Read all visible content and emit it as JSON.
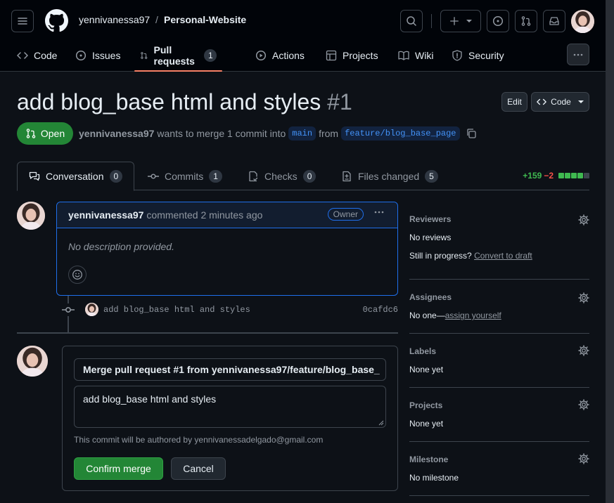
{
  "header": {
    "owner": "yennivanessa97",
    "separator": "/",
    "repo": "Personal-Website"
  },
  "nav": {
    "items": [
      {
        "label": "Code",
        "icon": "code-icon"
      },
      {
        "label": "Issues",
        "icon": "issue-icon"
      },
      {
        "label": "Pull requests",
        "icon": "pull-request-icon",
        "count": "1",
        "active": true
      },
      {
        "label": "Actions",
        "icon": "play-icon"
      },
      {
        "label": "Projects",
        "icon": "table-icon"
      },
      {
        "label": "Wiki",
        "icon": "book-icon"
      },
      {
        "label": "Security",
        "icon": "shield-icon"
      }
    ]
  },
  "pr": {
    "title": "add blog_base html and styles",
    "number": "#1",
    "edit_label": "Edit",
    "code_label": "Code",
    "state": "Open",
    "author": "yennivanessa97",
    "meta_text": "wants to merge 1 commit into",
    "base_branch": "main",
    "from_text": "from",
    "head_branch": "feature/blog_base_page"
  },
  "tabs": [
    {
      "label": "Conversation",
      "count": "0",
      "active": true
    },
    {
      "label": "Commits",
      "count": "1"
    },
    {
      "label": "Checks",
      "count": "0"
    },
    {
      "label": "Files changed",
      "count": "5"
    }
  ],
  "diffstat": {
    "additions": "+159",
    "deletions": "−2",
    "colors": [
      "#3fb950",
      "#3fb950",
      "#3fb950",
      "#3fb950",
      "#3d444d"
    ]
  },
  "comment": {
    "author": "yennivanessa97",
    "action": "commented 2 minutes ago",
    "badge": "Owner",
    "body": "No description provided."
  },
  "commit": {
    "message": "add blog_base html and styles",
    "sha": "0cafdc6"
  },
  "merge": {
    "title_value": "Merge pull request #1 from yennivanessa97/feature/blog_base_",
    "message_value": "add blog_base html and styles",
    "author_note": "This commit will be authored by yennivanessadelgado@gmail.com",
    "confirm_label": "Confirm merge",
    "cancel_label": "Cancel"
  },
  "sidebar": {
    "reviewers": {
      "heading": "Reviewers",
      "value": "No reviews",
      "progress_text": "Still in progress?",
      "progress_link": "Convert to draft"
    },
    "assignees": {
      "heading": "Assignees",
      "value": "No one—",
      "link": "assign yourself"
    },
    "labels": {
      "heading": "Labels",
      "value": "None yet"
    },
    "projects": {
      "heading": "Projects",
      "value": "None yet"
    },
    "milestone": {
      "heading": "Milestone",
      "value": "No milestone"
    }
  },
  "colors": {
    "accent_green": "#238636",
    "accent_blue": "#1f6feb",
    "nav_underline": "#f78166"
  }
}
